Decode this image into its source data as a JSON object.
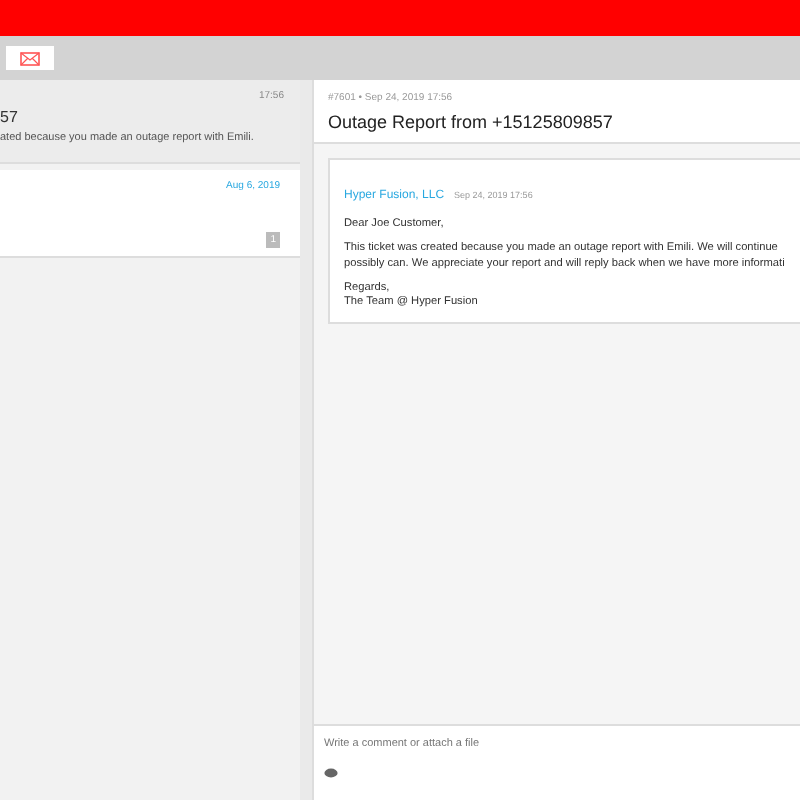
{
  "toolbar": {
    "buttons": [
      {
        "kind": "email",
        "selected": true
      }
    ]
  },
  "tickets": [
    {
      "time": "17:56",
      "title": "57",
      "snippet": "ated because you made an outage report with Emili.",
      "selected": true
    },
    {
      "time": "Aug 6, 2019",
      "badge": "1",
      "selected": false
    }
  ],
  "detail": {
    "meta": "#7601 • Sep 24, 2019 17:56",
    "title": "Outage Report from +15125809857",
    "message": {
      "author": "Hyper Fusion, LLC",
      "time": "Sep 24, 2019 17:56",
      "greeting": "Dear Joe Customer,",
      "body": [
        "This ticket was created because you made an outage report with Emili. We will continue",
        "possibly can. We appreciate your report and will reply back when we have more informati"
      ],
      "signoff": [
        "Regards,",
        "The Team @ Hyper Fusion"
      ]
    },
    "comment": {
      "placeholder": "Write a comment or attach a file"
    }
  }
}
